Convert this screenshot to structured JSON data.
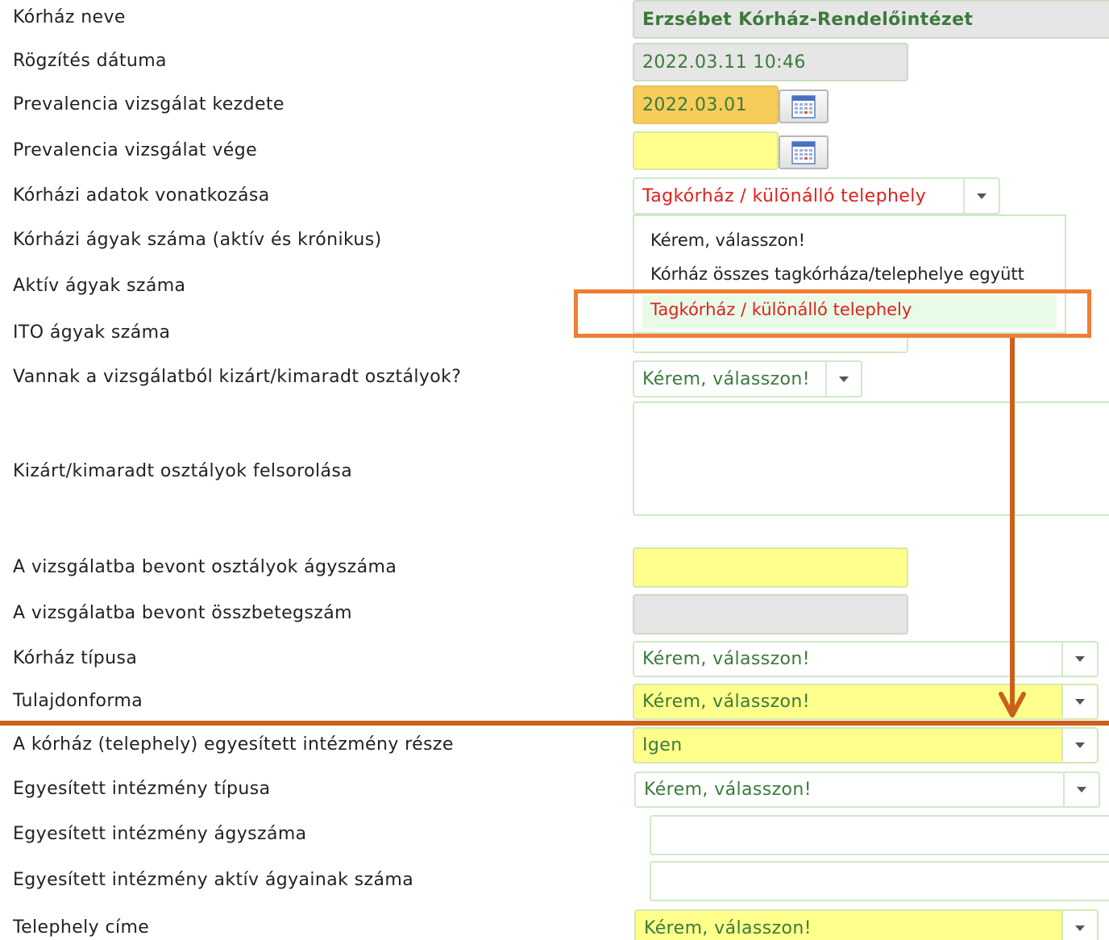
{
  "labels": {
    "hospital_name": "Kórház neve",
    "record_date": "Rögzítés dátuma",
    "prev_start": "Prevalencia vizsgálat kezdete",
    "prev_end": "Prevalencia vizsgálat vége",
    "data_scope": "Kórházi adatok vonatkozása",
    "beds_total": "Kórházi ágyak száma (aktív és krónikus)",
    "beds_active": "Aktív ágyak száma",
    "beds_ito": "ITO ágyak száma",
    "excluded_q": "Vannak a vizsgálatból kizárt/kimaradt osztályok?",
    "excluded_list": "Kizárt/kimaradt osztályok felsorolása",
    "included_beds": "A vizsgálatba bevont osztályok ágyszáma",
    "included_patients": "A vizsgálatba bevont összbetegszám",
    "hospital_type": "Kórház típusa",
    "ownership": "Tulajdonforma",
    "merged_part": "A kórház (telephely) egyesített intézmény része",
    "merged_type": "Egyesített intézmény típusa",
    "merged_beds": "Egyesített intézmény ágyszáma",
    "merged_active_beds": "Egyesített intézmény aktív ágyainak száma",
    "site_address": "Telephely címe"
  },
  "values": {
    "hospital_name": "Erzsébet Kórház-Rendelőintézet",
    "record_date": "2022.03.11 10:46",
    "prev_start": "2022.03.01",
    "prev_end": "",
    "data_scope": "Tagkórház / különálló telephely",
    "excluded_q": "Kérem, válasszon!",
    "excluded_list": "",
    "included_beds": "",
    "included_patients": "",
    "hospital_type": "Kérem, válasszon!",
    "ownership": "Kérem, válasszon!",
    "merged_part": "Igen",
    "merged_type": "Kérem, válasszon!",
    "merged_beds": "",
    "merged_active_beds": "",
    "site_address": "Kérem, válasszon!"
  },
  "dropdown": {
    "options": [
      "Kérem, válasszon!",
      "Kórház összes tagkórháza/telephelye együtt",
      "Tagkórház / különálló telephely"
    ],
    "selected": "Tagkórház / különálló telephely"
  },
  "icons": {
    "calendar": "calendar-icon",
    "select_arrow": "chevron-down-icon"
  },
  "colors": {
    "field_text": "#3b7a3b",
    "selected_text": "#e02020",
    "required_yellow": "#ffff8c",
    "grey_readonly": "#e6e6e6",
    "highlight_orange": "#f6cd5a",
    "annotation_box": "#ef7d32",
    "annotation_arrow": "#c9611d"
  }
}
